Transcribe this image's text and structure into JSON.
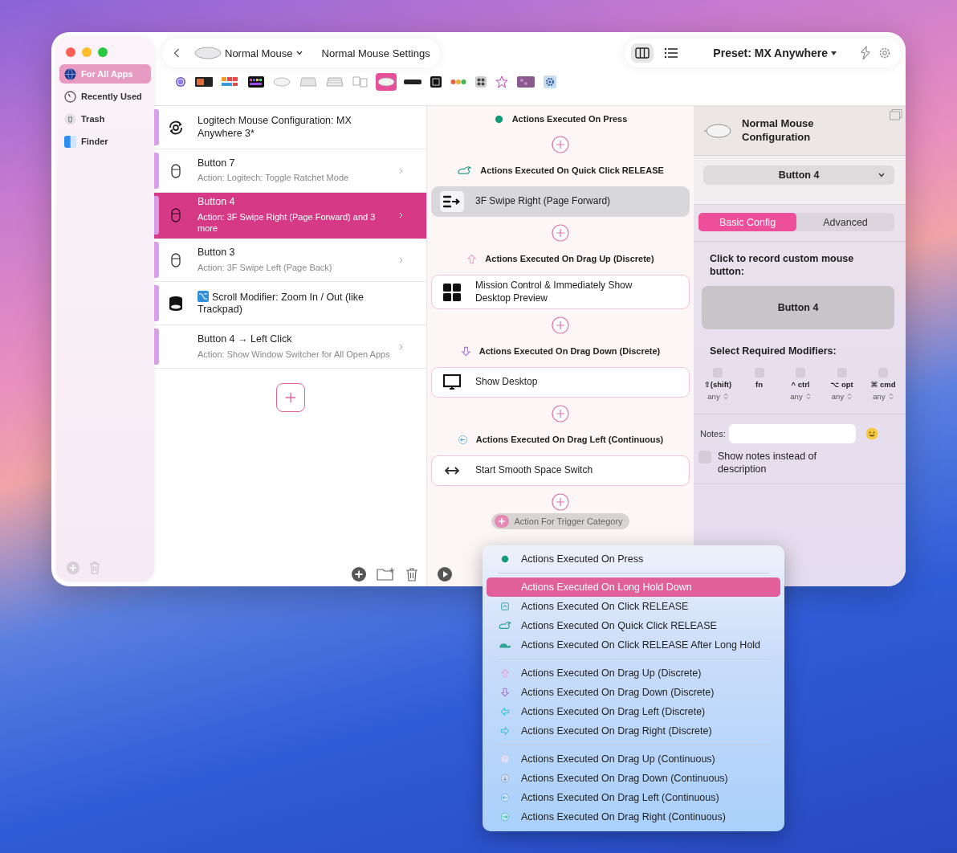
{
  "sidebar": {
    "items": [
      {
        "label": "For All Apps",
        "kind": "globe",
        "selected": true
      },
      {
        "label": "Recently Used",
        "kind": "clock",
        "selected": false
      },
      {
        "label": "Trash",
        "kind": "trash",
        "selected": false
      },
      {
        "label": "Finder",
        "kind": "finder",
        "selected": false
      }
    ]
  },
  "toolbar": {
    "device": "Normal Mouse",
    "title": "Normal Mouse Settings",
    "views": [
      {
        "kind": "columns",
        "selected": true
      },
      {
        "kind": "list",
        "selected": false
      }
    ],
    "preset": "Preset: MX Anywhere"
  },
  "devices": [
    {
      "kind": "ring",
      "selected": false
    },
    {
      "kind": "display",
      "selected": false
    },
    {
      "kind": "bars",
      "selected": false
    },
    {
      "kind": "rgb-keyboard",
      "selected": false
    },
    {
      "kind": "mouse",
      "selected": false
    },
    {
      "kind": "trackpad",
      "selected": false
    },
    {
      "kind": "keyboard",
      "selected": false
    },
    {
      "kind": "keys",
      "selected": false
    },
    {
      "kind": "mouse",
      "selected": true
    },
    {
      "kind": "bar",
      "selected": false
    },
    {
      "kind": "square",
      "selected": false
    },
    {
      "kind": "dots",
      "selected": false
    },
    {
      "kind": "grid",
      "selected": false
    },
    {
      "kind": "star",
      "selected": false
    },
    {
      "kind": "pad",
      "selected": false
    },
    {
      "kind": "gear",
      "selected": false
    }
  ],
  "triggers": [
    {
      "kind": "config",
      "title": "Logitech Mouse Configuration: MX Anywhere 3*",
      "selected": false
    },
    {
      "kind": "button",
      "title": "Button 7",
      "subtitle": "Action: Logitech: Toggle Ratchet Mode",
      "selected": false
    },
    {
      "kind": "button",
      "title": "Button 4",
      "subtitle": "Action: 3F Swipe Right (Page Forward) and 3 more",
      "selected": true
    },
    {
      "kind": "button",
      "title": "Button 3",
      "subtitle": "Action: 3F Swipe Left (Page Back)",
      "selected": false
    },
    {
      "kind": "scroll",
      "title": "Scroll Modifier: Zoom In / Out (like Trackpad)",
      "selected": false
    },
    {
      "kind": "plain",
      "title": "Button 4 → Left Click",
      "subtitle": "Action: Show Window Switcher for All Open Apps",
      "selected": false
    }
  ],
  "groups": [
    {
      "kind": "press",
      "title": "Actions Executed On Press"
    },
    {
      "kind": "quick",
      "title": "Actions Executed On Quick Click RELEASE",
      "actions": [
        {
          "kind": "swipe",
          "label": "3F Swipe Right (Page Forward)",
          "selected": true
        }
      ]
    },
    {
      "kind": "up",
      "title": "Actions Executed On Drag Up (Discrete)",
      "actions": [
        {
          "kind": "grid",
          "label": "Mission Control & Immediately Show Desktop Preview",
          "selected": false
        }
      ]
    },
    {
      "kind": "down",
      "title": "Actions Executed On Drag Down (Discrete)",
      "actions": [
        {
          "kind": "display",
          "label": "Show Desktop",
          "selected": false
        }
      ]
    },
    {
      "kind": "left-cont",
      "title": "Actions Executed On Drag Left (Continuous)",
      "actions": [
        {
          "kind": "arrows",
          "label": "Start Smooth Space Switch",
          "selected": false
        }
      ]
    }
  ],
  "add_category": "Action For Trigger Category",
  "inspector": {
    "title": "Normal Mouse Configuration",
    "button_select": "Button 4",
    "tabs": [
      {
        "label": "Basic Config",
        "selected": true
      },
      {
        "label": "Advanced",
        "selected": false
      }
    ],
    "record_label": "Click to record custom mouse button:",
    "record_button": "Button 4",
    "modifiers_label": "Select Required Modifiers:",
    "modifiers": [
      {
        "label": "⇧(shift)",
        "checked": false,
        "value": "any"
      },
      {
        "label": "fn",
        "checked": false
      },
      {
        "label": "^ ctrl",
        "checked": false,
        "value": "any"
      },
      {
        "label": "⌥ opt",
        "checked": false,
        "value": "any"
      },
      {
        "label": "⌘ cmd",
        "checked": false,
        "value": "any"
      }
    ],
    "notes_label": "Notes:",
    "show_notes": {
      "label": "Show notes instead of description",
      "checked": false
    }
  },
  "menu": {
    "sections": [
      {
        "items": [
          {
            "kind": "press",
            "label": "Actions Executed On Press",
            "selected": false
          }
        ]
      },
      {
        "items": [
          {
            "kind": "long-hold",
            "label": "Actions Executed On Long Hold Down",
            "selected": true
          },
          {
            "kind": "click-release",
            "label": "Actions Executed On Click RELEASE",
            "selected": false
          },
          {
            "kind": "quick",
            "label": "Actions Executed On Quick Click RELEASE",
            "selected": false
          },
          {
            "kind": "slow",
            "label": "Actions Executed On Click RELEASE After Long Hold",
            "selected": false
          }
        ]
      },
      {
        "items": [
          {
            "kind": "up",
            "label": "Actions Executed On Drag Up (Discrete)",
            "selected": false
          },
          {
            "kind": "down",
            "label": "Actions Executed On Drag Down (Discrete)",
            "selected": false
          },
          {
            "kind": "left",
            "label": "Actions Executed On Drag Left (Discrete)",
            "selected": false
          },
          {
            "kind": "right",
            "label": "Actions Executed On Drag Right (Discrete)",
            "selected": false
          }
        ]
      },
      {
        "items": [
          {
            "kind": "up-cont",
            "label": "Actions Executed On Drag Up (Continuous)",
            "selected": false
          },
          {
            "kind": "down-cont",
            "label": "Actions Executed On Drag Down (Continuous)",
            "selected": false
          },
          {
            "kind": "left-cont",
            "label": "Actions Executed On Drag Left (Continuous)",
            "selected": false
          },
          {
            "kind": "right-cont",
            "label": "Actions Executed On Drag Right (Continuous)",
            "selected": false
          }
        ]
      }
    ]
  }
}
